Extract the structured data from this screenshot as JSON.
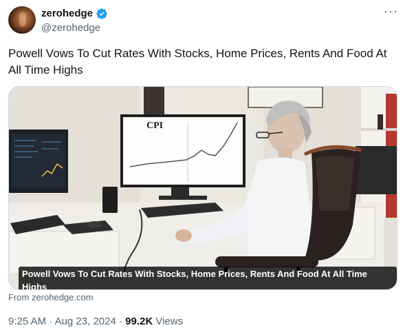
{
  "author": {
    "display_name": "zerohedge",
    "handle": "@zerohedge",
    "verified": true,
    "verified_color": "#1d9bf0"
  },
  "tweet": {
    "text": "Powell Vows To Cut Rates With Stocks, Home Prices, Rents And Food At All Time Highs"
  },
  "media": {
    "caption": "Powell Vows To Cut Rates With Stocks, Home Prices, Rents And Food At All Time Highs",
    "monitor_label": "CPI"
  },
  "link_card": {
    "source_text": "From zerohedge.com"
  },
  "meta": {
    "time": "9:25 AM",
    "separator": "·",
    "date": "Aug 23, 2024",
    "views_count": "99.2K",
    "views_label": "Views"
  },
  "icons": {
    "more": "more-icon",
    "verified": "verified-badge-icon"
  }
}
